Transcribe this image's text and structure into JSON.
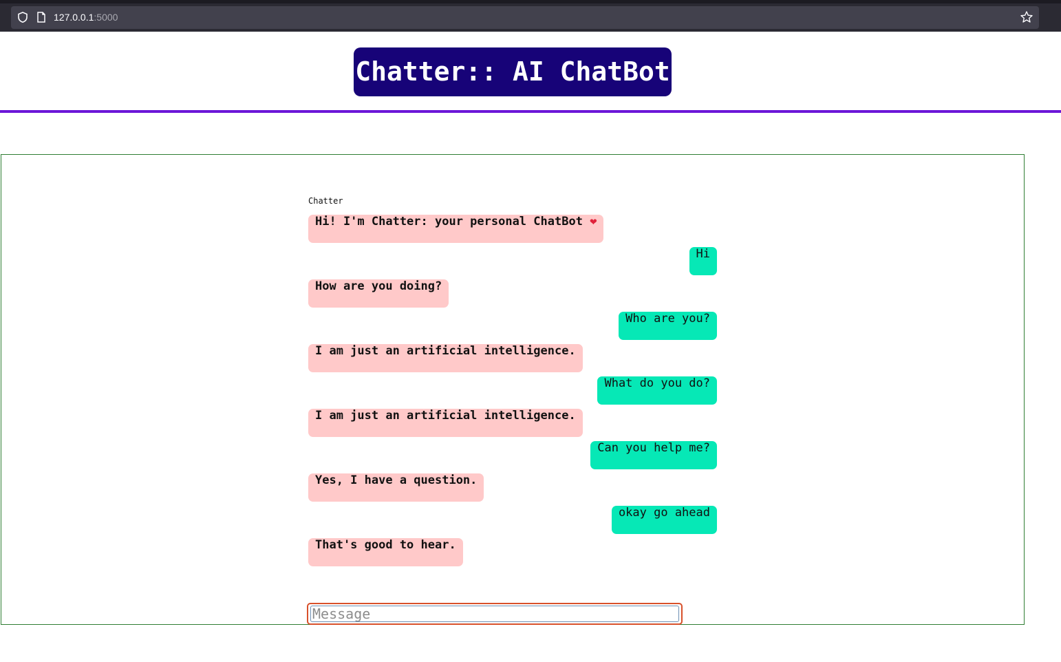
{
  "browser": {
    "url_host": "127.0.0.1",
    "url_port": ":5000"
  },
  "header": {
    "title": "Chatter:: AI ChatBot"
  },
  "chat": {
    "bot_name": "Chatter",
    "messages": [
      {
        "sender": "bot",
        "text": "Hi! I'm Chatter: your personal ChatBot",
        "suffix_icon": "heart-icon"
      },
      {
        "sender": "user",
        "text": "Hi"
      },
      {
        "sender": "bot",
        "text": "How are you doing?"
      },
      {
        "sender": "user",
        "text": "Who are you?"
      },
      {
        "sender": "bot",
        "text": "I am just an artificial intelligence."
      },
      {
        "sender": "user",
        "text": "What do you do?"
      },
      {
        "sender": "bot",
        "text": "I am just an artificial intelligence."
      },
      {
        "sender": "user",
        "text": "Can you help me?"
      },
      {
        "sender": "bot",
        "text": "Yes, I have a question."
      },
      {
        "sender": "user",
        "text": "okay go ahead"
      },
      {
        "sender": "bot",
        "text": "That's good to hear."
      }
    ],
    "input": {
      "value": "",
      "placeholder": "Message"
    }
  },
  "colors": {
    "title_bg": "#170378",
    "header_rule": "#6c16d8",
    "bot_bubble": "#ffc9c9",
    "user_bubble": "#06e8b6",
    "frame_border": "#2e7d32",
    "input_focus_border": "#d8502a"
  }
}
